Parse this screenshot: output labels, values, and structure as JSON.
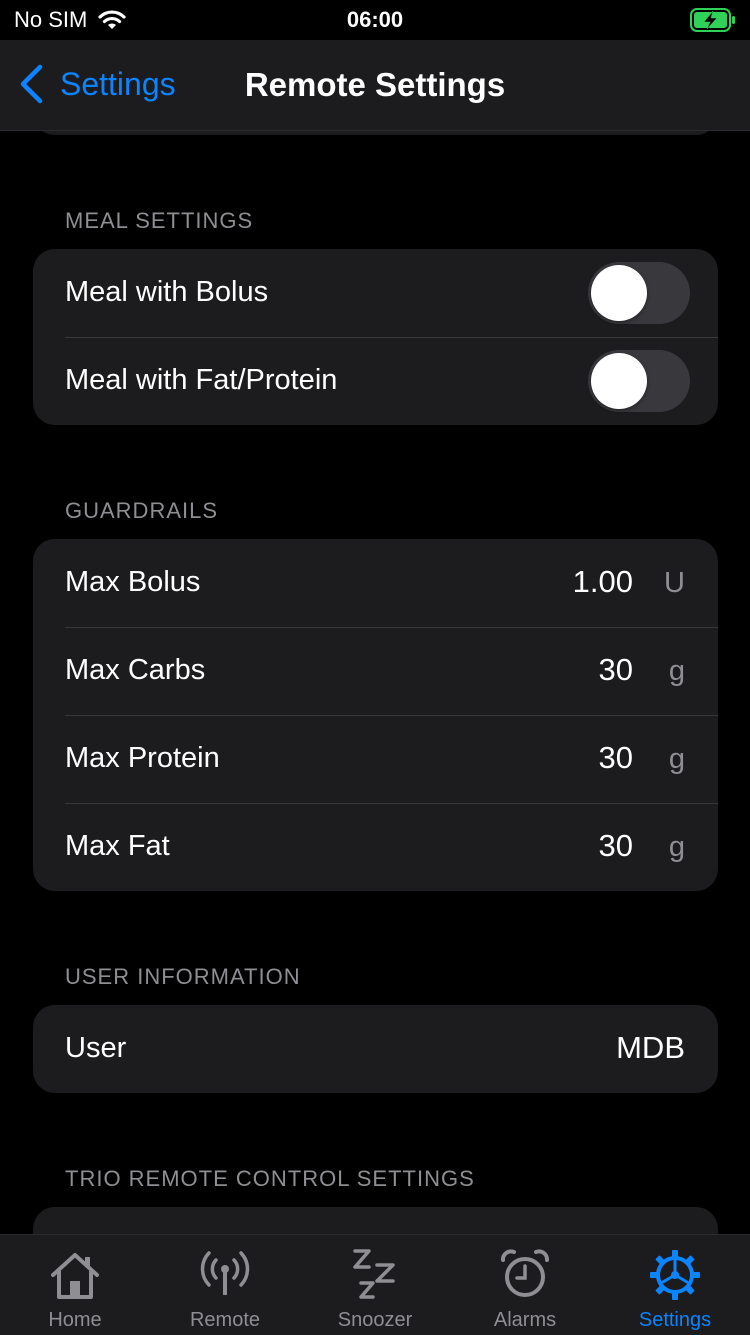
{
  "status_bar": {
    "carrier": "No SIM",
    "time": "06:00"
  },
  "nav": {
    "back_label": "Settings",
    "title": "Remote Settings"
  },
  "sections": {
    "meal": {
      "header": "MEAL SETTINGS",
      "rows": [
        {
          "label": "Meal with Bolus",
          "toggle_on": false
        },
        {
          "label": "Meal with Fat/Protein",
          "toggle_on": false
        }
      ]
    },
    "guardrails": {
      "header": "GUARDRAILS",
      "rows": [
        {
          "label": "Max Bolus",
          "value": "1.00",
          "unit": "U"
        },
        {
          "label": "Max Carbs",
          "value": "30",
          "unit": "g"
        },
        {
          "label": "Max Protein",
          "value": "30",
          "unit": "g"
        },
        {
          "label": "Max Fat",
          "value": "30",
          "unit": "g"
        }
      ]
    },
    "user_info": {
      "header": "USER INFORMATION",
      "rows": [
        {
          "label": "User",
          "value": "MDB"
        }
      ]
    },
    "trio": {
      "header": "TRIO REMOTE CONTROL SETTINGS"
    }
  },
  "tabs": [
    {
      "label": "Home",
      "icon": "house-icon"
    },
    {
      "label": "Remote",
      "icon": "antenna-icon"
    },
    {
      "label": "Snoozer",
      "icon": "zzz-icon"
    },
    {
      "label": "Alarms",
      "icon": "alarm-clock-icon"
    },
    {
      "label": "Settings",
      "icon": "gear-icon",
      "active": true
    }
  ],
  "colors": {
    "accent": "#0a84ff",
    "card": "#1c1c1e",
    "secondary_text": "#8e8e93",
    "battery": "#30d158"
  }
}
